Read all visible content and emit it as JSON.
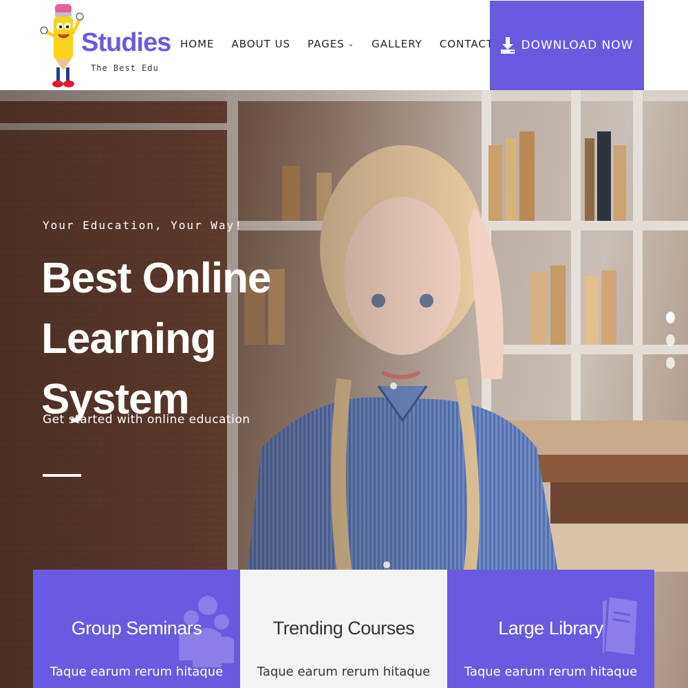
{
  "brand": {
    "name": "Studies",
    "tagline": "The Best Edu"
  },
  "nav": {
    "items": [
      {
        "label": "HOME"
      },
      {
        "label": "ABOUT US"
      },
      {
        "label": "PAGES",
        "has_dropdown": true
      },
      {
        "label": "GALLERY"
      },
      {
        "label": "CONTACT US"
      }
    ]
  },
  "download": {
    "label": "DOWNLOAD NOW",
    "icon": "download-icon"
  },
  "hero": {
    "eyebrow": "Your Education, Your Way!",
    "title_line1": "Best Online",
    "title_line2": "Learning System",
    "subtitle": "Get started with online education",
    "slides": 3,
    "active_slide": 1
  },
  "features": [
    {
      "title": "Group Seminars",
      "text": "Taque earum rerum hitaque",
      "icon": "group-icon"
    },
    {
      "title": "Trending Courses",
      "text": "Taque earum rerum hitaque"
    },
    {
      "title": "Large Library",
      "text": "Taque earum rerum hitaque",
      "icon": "book-icon"
    }
  ],
  "colors": {
    "accent": "#6a5ae0",
    "light_card": "#f4f4f6"
  }
}
